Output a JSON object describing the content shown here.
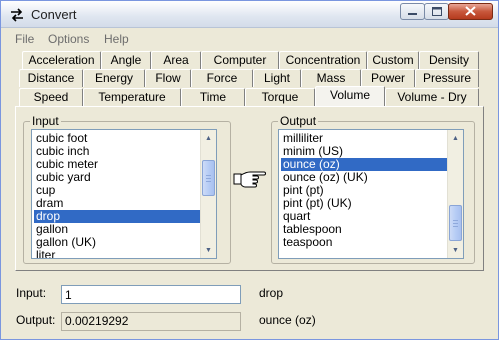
{
  "window": {
    "title": "Convert"
  },
  "menu": [
    "File",
    "Options",
    "Help"
  ],
  "tabs": {
    "row1": [
      "Acceleration",
      "Angle",
      "Area",
      "Computer",
      "Concentration",
      "Custom",
      "Density"
    ],
    "row2": [
      "Distance",
      "Energy",
      "Flow",
      "Force",
      "Light",
      "Mass",
      "Power",
      "Pressure"
    ],
    "row3": [
      "Speed",
      "Temperature",
      "Time",
      "Torque",
      "Volume",
      "Volume - Dry"
    ],
    "active": "Volume"
  },
  "input_group": {
    "legend": "Input",
    "items": [
      "cubic foot",
      "cubic inch",
      "cubic meter",
      "cubic yard",
      "cup",
      "dram",
      "drop",
      "gallon",
      "gallon (UK)",
      "liter"
    ],
    "selected": "drop"
  },
  "output_group": {
    "legend": "Output",
    "items": [
      "milliliter",
      "minim (US)",
      "ounce (oz)",
      "ounce (oz) (UK)",
      "pint (pt)",
      "pint (pt) (UK)",
      "quart",
      "tablespoon",
      "teaspoon"
    ],
    "selected": "ounce (oz)"
  },
  "fields": {
    "input_label": "Input:",
    "input_value": "1",
    "input_unit": "drop",
    "output_label": "Output:",
    "output_value": "0.00219292",
    "output_unit": "ounce (oz)"
  },
  "icons": {
    "app": "convert-arrows-icon",
    "pointer": "pointing-hand-icon"
  },
  "colors": {
    "selection": "#316ac5",
    "window_bg": "#ece9d8",
    "close_button": "#c8583c"
  }
}
